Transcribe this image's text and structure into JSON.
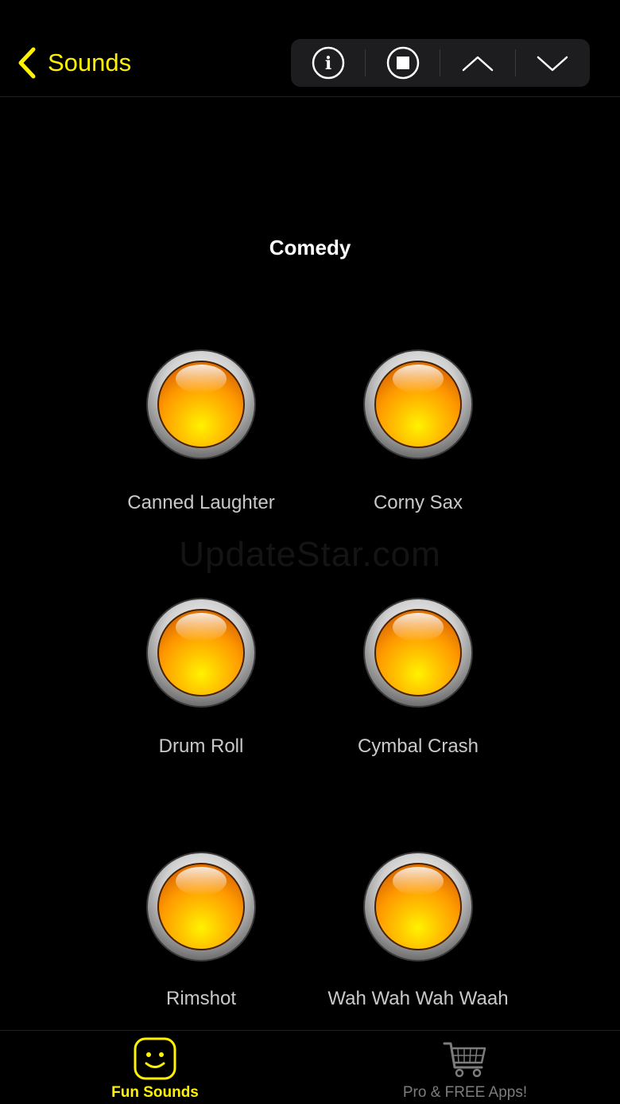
{
  "header": {
    "back_label": "Sounds",
    "toolbar": {
      "info_icon": "info-circle-icon",
      "stop_icon": "stop-circle-icon",
      "up_icon": "chevron-up-icon",
      "down_icon": "chevron-down-icon"
    }
  },
  "section": {
    "title": "Comedy"
  },
  "watermark": "UpdateStar.com",
  "sounds": [
    {
      "label": "Canned Laughter"
    },
    {
      "label": "Corny Sax"
    },
    {
      "label": "Drum Roll"
    },
    {
      "label": "Cymbal Crash"
    },
    {
      "label": "Rimshot"
    },
    {
      "label": "Wah Wah Wah Waah"
    }
  ],
  "tabbar": {
    "tabs": [
      {
        "label": "Fun Sounds",
        "icon": "smiley-face-icon",
        "active": true
      },
      {
        "label": "Pro & FREE Apps!",
        "icon": "shopping-cart-icon",
        "active": false
      }
    ]
  },
  "colors": {
    "accent": "#fff200",
    "background": "#000000",
    "button_orange": "#ff9d00"
  }
}
